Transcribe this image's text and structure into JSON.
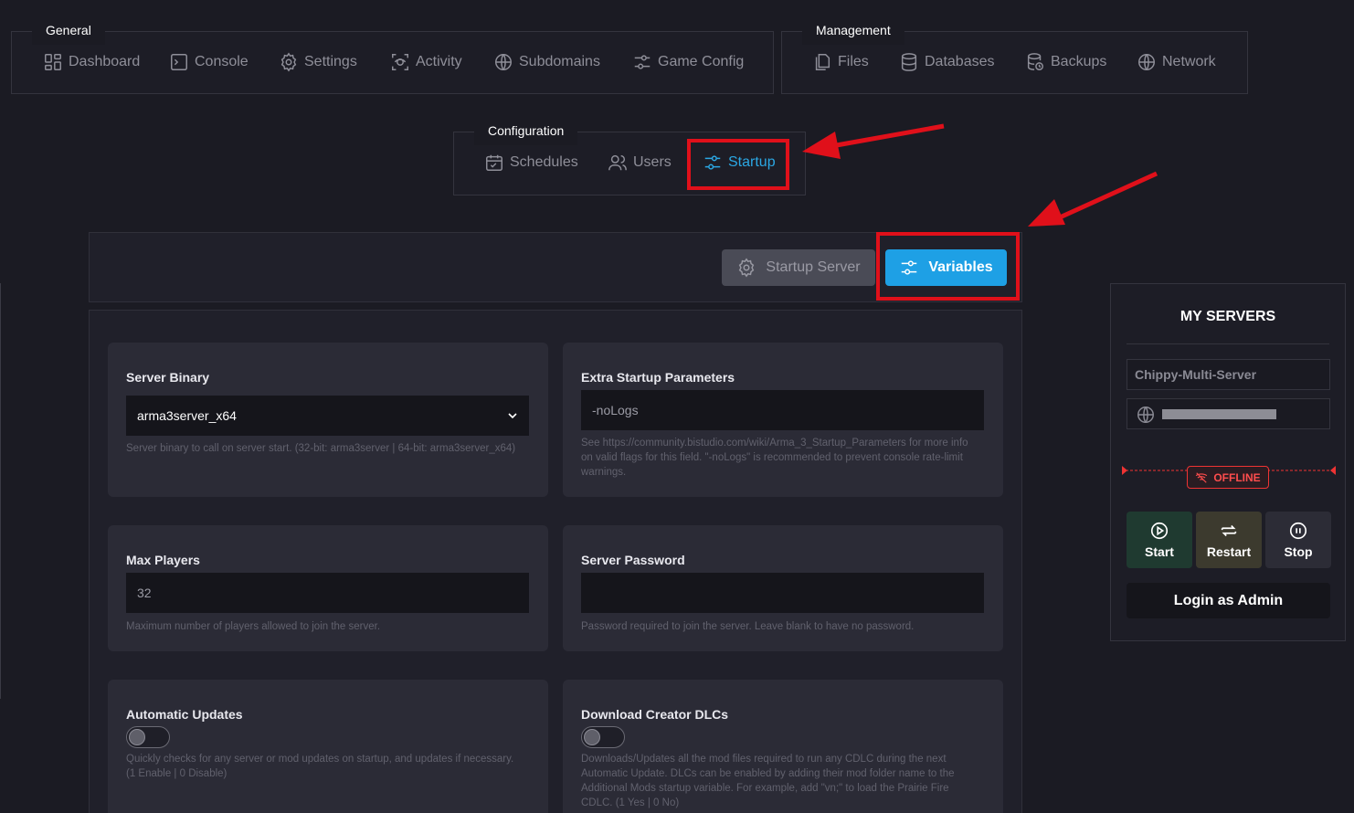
{
  "nav": {
    "general": {
      "legend": "General",
      "items": [
        {
          "label": "Dashboard",
          "icon": "dashboard-icon"
        },
        {
          "label": "Console",
          "icon": "console-icon"
        },
        {
          "label": "Settings",
          "icon": "gear-icon"
        },
        {
          "label": "Activity",
          "icon": "activity-icon"
        },
        {
          "label": "Subdomains",
          "icon": "globe-icon"
        },
        {
          "label": "Game Config",
          "icon": "sliders-icon"
        }
      ]
    },
    "management": {
      "legend": "Management",
      "items": [
        {
          "label": "Files",
          "icon": "files-icon"
        },
        {
          "label": "Databases",
          "icon": "database-icon"
        },
        {
          "label": "Backups",
          "icon": "backup-icon"
        },
        {
          "label": "Network",
          "icon": "network-globe-icon"
        }
      ]
    },
    "configuration": {
      "legend": "Configuration",
      "items": [
        {
          "label": "Schedules",
          "icon": "calendar-icon"
        },
        {
          "label": "Users",
          "icon": "users-icon"
        },
        {
          "label": "Startup",
          "icon": "sliders-icon",
          "active": true
        }
      ]
    }
  },
  "toolbar": {
    "startup_server_label": "Startup Server",
    "variables_label": "Variables"
  },
  "variables": {
    "server_binary": {
      "title": "Server Binary",
      "value": "arma3server_x64",
      "desc": "Server binary to call on server start. (32-bit: arma3server | 64-bit: arma3server_x64)"
    },
    "extra_params": {
      "title": "Extra Startup Parameters",
      "value": "-noLogs",
      "desc": "See https://community.bistudio.com/wiki/Arma_3_Startup_Parameters for more info on valid flags for this field. \"-noLogs\" is recommended to prevent console rate-limit warnings."
    },
    "max_players": {
      "title": "Max Players",
      "value": "32",
      "desc": "Maximum number of players allowed to join the server."
    },
    "server_password": {
      "title": "Server Password",
      "value": "",
      "desc": "Password required to join the server. Leave blank to have no password."
    },
    "auto_updates": {
      "title": "Automatic Updates",
      "enabled": false,
      "desc": "Quickly checks for any server or mod updates on startup, and updates if necessary. (1 Enable | 0 Disable)"
    },
    "creator_dlcs": {
      "title": "Download Creator DLCs",
      "enabled": false,
      "desc": "Downloads/Updates all the mod files required to run any CDLC during the next Automatic Update. DLCs can be enabled by adding their mod folder name to the Additional Mods startup variable. For example, add \"vn;\" to load the Prairie Fire CDLC. (1 Yes | 0 No)"
    }
  },
  "my_servers": {
    "title": "MY SERVERS",
    "server_name": "Chippy-Multi-Server",
    "address": "",
    "status": "OFFLINE",
    "buttons": {
      "start": "Start",
      "restart": "Restart",
      "stop": "Stop"
    },
    "login_admin": "Login as Admin"
  },
  "colors": {
    "accent": "#2ba7e3",
    "highlight": "#e0101a",
    "start_bg": "#1f3a30",
    "restart_bg": "#3c3a2e",
    "stop_bg": "#2c2c36",
    "offline": "#ff4d4d"
  }
}
